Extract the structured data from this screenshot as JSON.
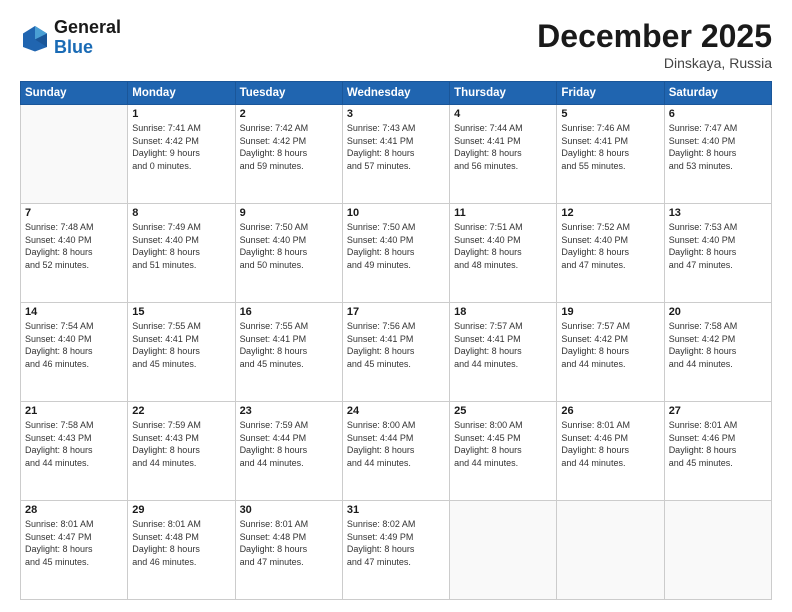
{
  "header": {
    "logo_line1": "General",
    "logo_line2": "Blue",
    "month": "December 2025",
    "location": "Dinskaya, Russia"
  },
  "weekdays": [
    "Sunday",
    "Monday",
    "Tuesday",
    "Wednesday",
    "Thursday",
    "Friday",
    "Saturday"
  ],
  "weeks": [
    [
      {
        "day": "",
        "info": ""
      },
      {
        "day": "1",
        "info": "Sunrise: 7:41 AM\nSunset: 4:42 PM\nDaylight: 9 hours\nand 0 minutes."
      },
      {
        "day": "2",
        "info": "Sunrise: 7:42 AM\nSunset: 4:42 PM\nDaylight: 8 hours\nand 59 minutes."
      },
      {
        "day": "3",
        "info": "Sunrise: 7:43 AM\nSunset: 4:41 PM\nDaylight: 8 hours\nand 57 minutes."
      },
      {
        "day": "4",
        "info": "Sunrise: 7:44 AM\nSunset: 4:41 PM\nDaylight: 8 hours\nand 56 minutes."
      },
      {
        "day": "5",
        "info": "Sunrise: 7:46 AM\nSunset: 4:41 PM\nDaylight: 8 hours\nand 55 minutes."
      },
      {
        "day": "6",
        "info": "Sunrise: 7:47 AM\nSunset: 4:40 PM\nDaylight: 8 hours\nand 53 minutes."
      }
    ],
    [
      {
        "day": "7",
        "info": "Sunrise: 7:48 AM\nSunset: 4:40 PM\nDaylight: 8 hours\nand 52 minutes."
      },
      {
        "day": "8",
        "info": "Sunrise: 7:49 AM\nSunset: 4:40 PM\nDaylight: 8 hours\nand 51 minutes."
      },
      {
        "day": "9",
        "info": "Sunrise: 7:50 AM\nSunset: 4:40 PM\nDaylight: 8 hours\nand 50 minutes."
      },
      {
        "day": "10",
        "info": "Sunrise: 7:50 AM\nSunset: 4:40 PM\nDaylight: 8 hours\nand 49 minutes."
      },
      {
        "day": "11",
        "info": "Sunrise: 7:51 AM\nSunset: 4:40 PM\nDaylight: 8 hours\nand 48 minutes."
      },
      {
        "day": "12",
        "info": "Sunrise: 7:52 AM\nSunset: 4:40 PM\nDaylight: 8 hours\nand 47 minutes."
      },
      {
        "day": "13",
        "info": "Sunrise: 7:53 AM\nSunset: 4:40 PM\nDaylight: 8 hours\nand 47 minutes."
      }
    ],
    [
      {
        "day": "14",
        "info": "Sunrise: 7:54 AM\nSunset: 4:40 PM\nDaylight: 8 hours\nand 46 minutes."
      },
      {
        "day": "15",
        "info": "Sunrise: 7:55 AM\nSunset: 4:41 PM\nDaylight: 8 hours\nand 45 minutes."
      },
      {
        "day": "16",
        "info": "Sunrise: 7:55 AM\nSunset: 4:41 PM\nDaylight: 8 hours\nand 45 minutes."
      },
      {
        "day": "17",
        "info": "Sunrise: 7:56 AM\nSunset: 4:41 PM\nDaylight: 8 hours\nand 45 minutes."
      },
      {
        "day": "18",
        "info": "Sunrise: 7:57 AM\nSunset: 4:41 PM\nDaylight: 8 hours\nand 44 minutes."
      },
      {
        "day": "19",
        "info": "Sunrise: 7:57 AM\nSunset: 4:42 PM\nDaylight: 8 hours\nand 44 minutes."
      },
      {
        "day": "20",
        "info": "Sunrise: 7:58 AM\nSunset: 4:42 PM\nDaylight: 8 hours\nand 44 minutes."
      }
    ],
    [
      {
        "day": "21",
        "info": "Sunrise: 7:58 AM\nSunset: 4:43 PM\nDaylight: 8 hours\nand 44 minutes."
      },
      {
        "day": "22",
        "info": "Sunrise: 7:59 AM\nSunset: 4:43 PM\nDaylight: 8 hours\nand 44 minutes."
      },
      {
        "day": "23",
        "info": "Sunrise: 7:59 AM\nSunset: 4:44 PM\nDaylight: 8 hours\nand 44 minutes."
      },
      {
        "day": "24",
        "info": "Sunrise: 8:00 AM\nSunset: 4:44 PM\nDaylight: 8 hours\nand 44 minutes."
      },
      {
        "day": "25",
        "info": "Sunrise: 8:00 AM\nSunset: 4:45 PM\nDaylight: 8 hours\nand 44 minutes."
      },
      {
        "day": "26",
        "info": "Sunrise: 8:01 AM\nSunset: 4:46 PM\nDaylight: 8 hours\nand 44 minutes."
      },
      {
        "day": "27",
        "info": "Sunrise: 8:01 AM\nSunset: 4:46 PM\nDaylight: 8 hours\nand 45 minutes."
      }
    ],
    [
      {
        "day": "28",
        "info": "Sunrise: 8:01 AM\nSunset: 4:47 PM\nDaylight: 8 hours\nand 45 minutes."
      },
      {
        "day": "29",
        "info": "Sunrise: 8:01 AM\nSunset: 4:48 PM\nDaylight: 8 hours\nand 46 minutes."
      },
      {
        "day": "30",
        "info": "Sunrise: 8:01 AM\nSunset: 4:48 PM\nDaylight: 8 hours\nand 47 minutes."
      },
      {
        "day": "31",
        "info": "Sunrise: 8:02 AM\nSunset: 4:49 PM\nDaylight: 8 hours\nand 47 minutes."
      },
      {
        "day": "",
        "info": ""
      },
      {
        "day": "",
        "info": ""
      },
      {
        "day": "",
        "info": ""
      }
    ]
  ]
}
